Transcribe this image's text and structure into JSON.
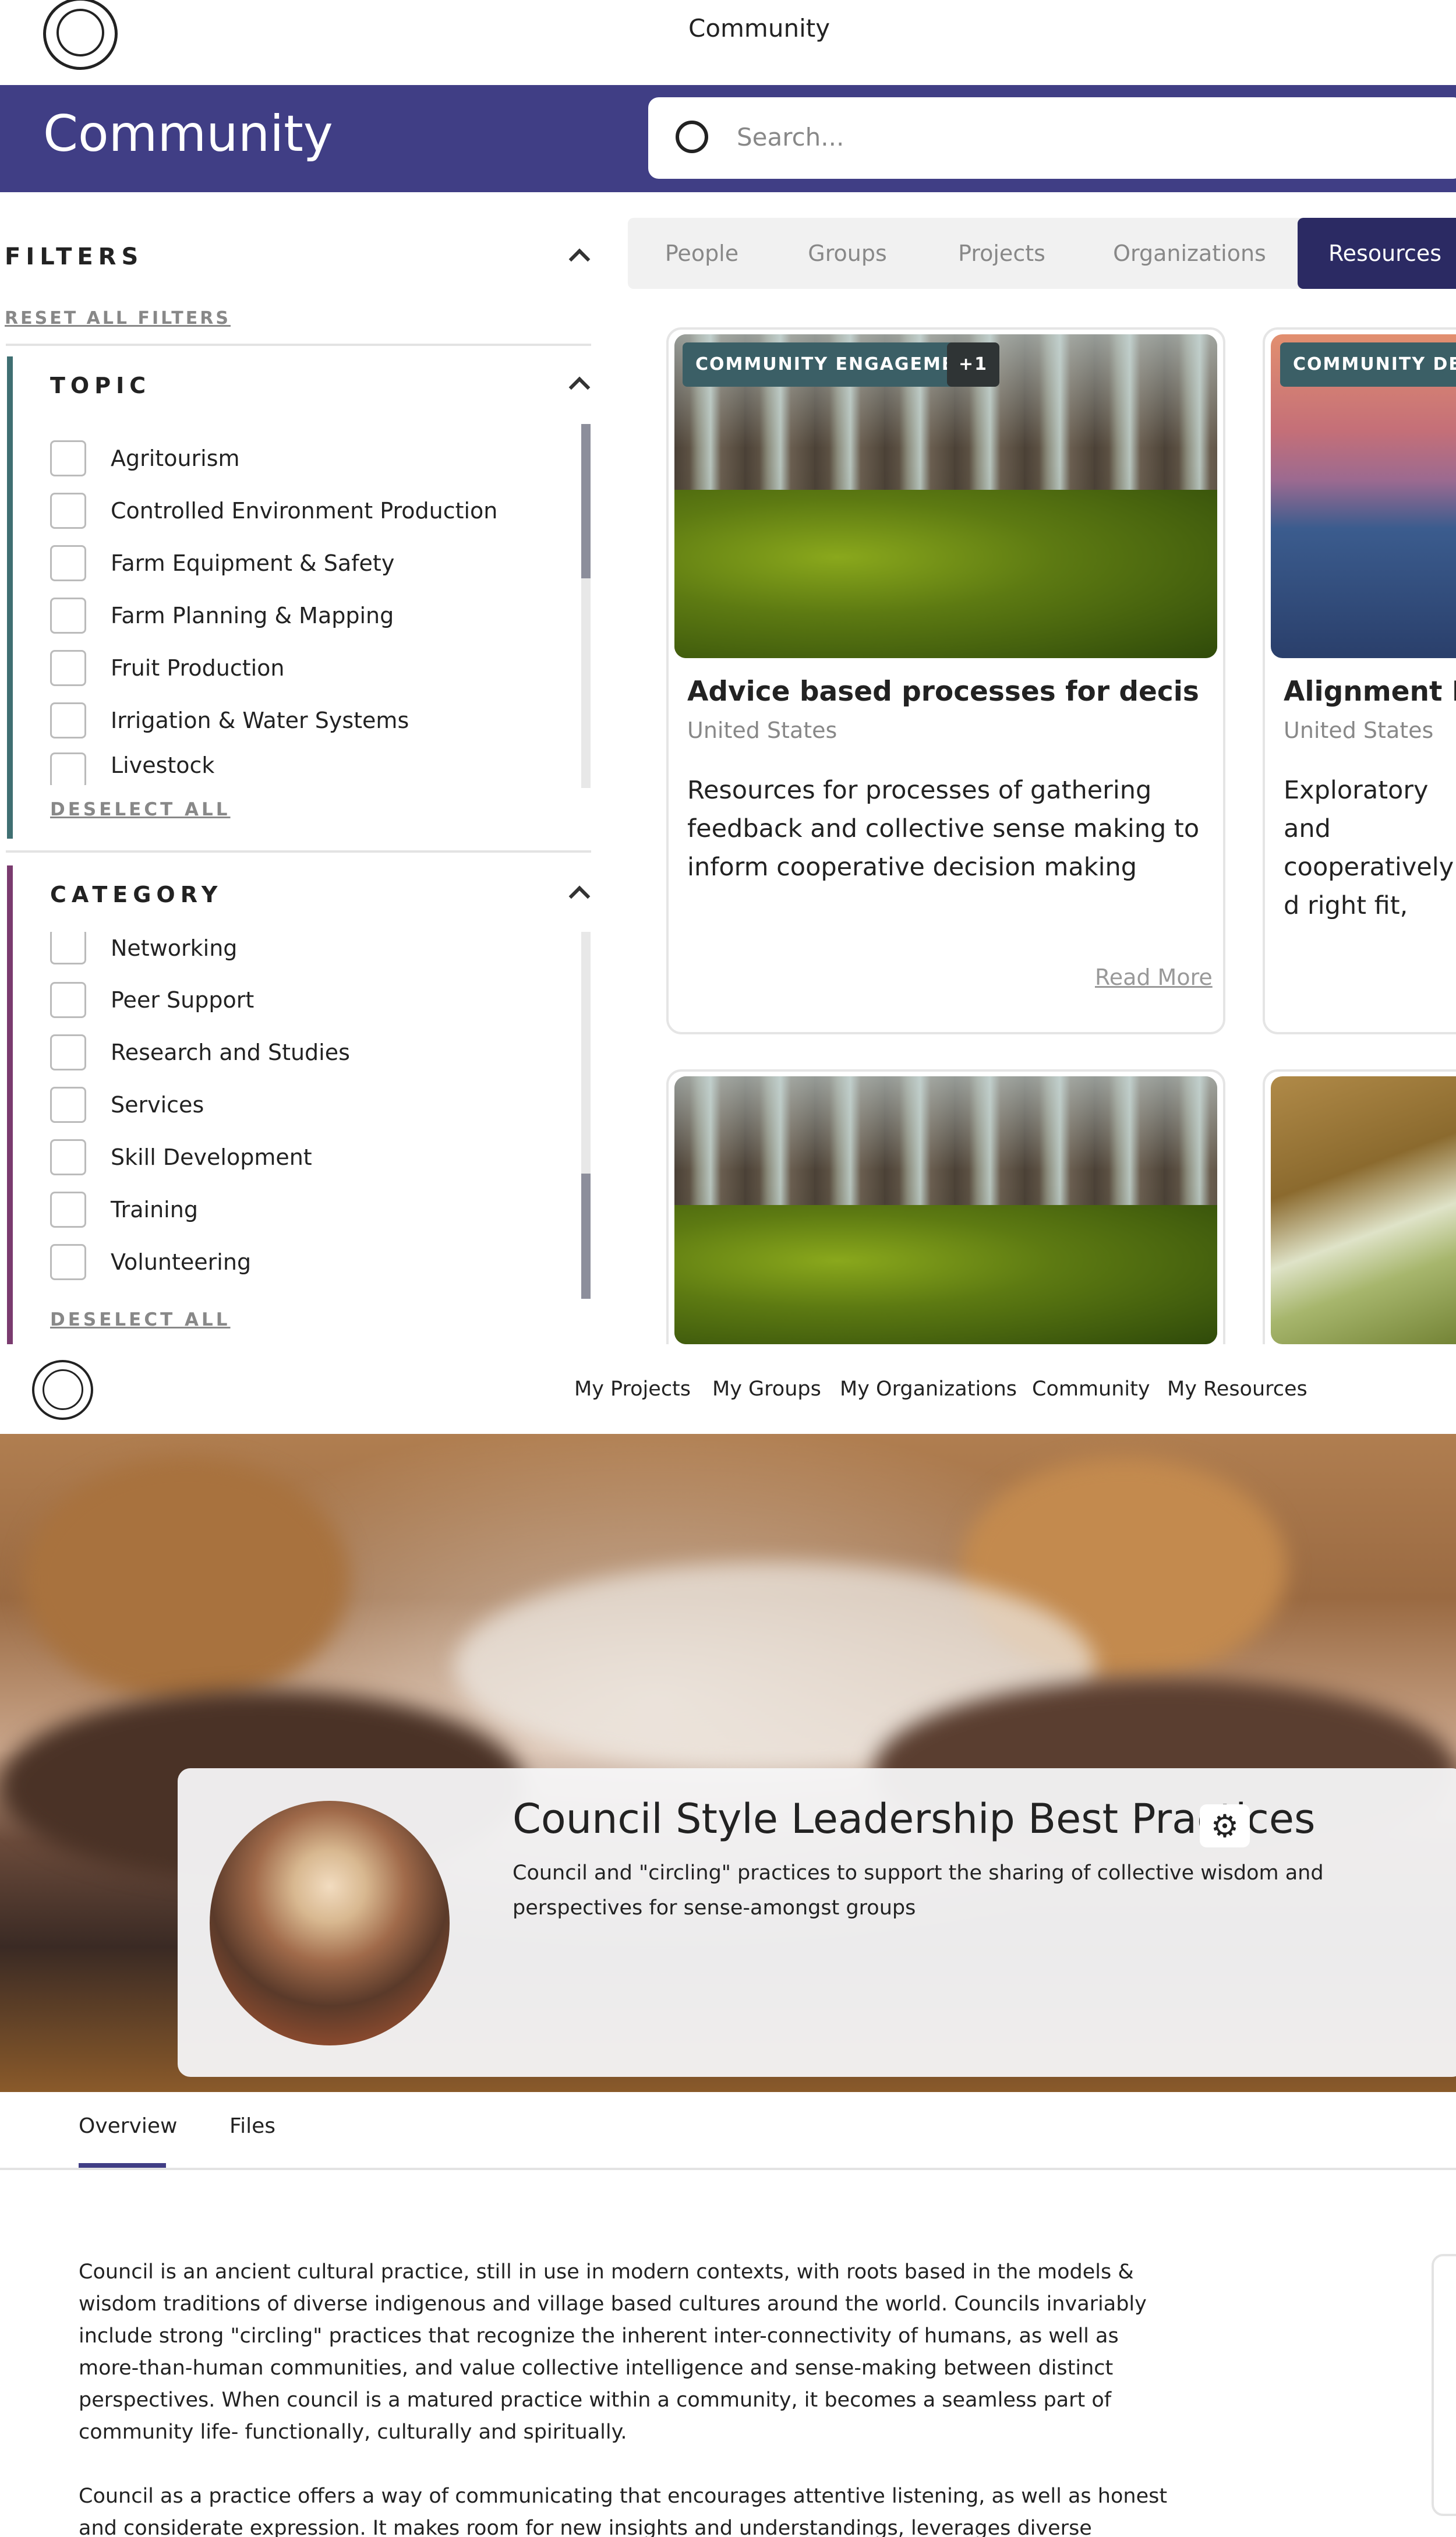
{
  "top_nav": {
    "title": "Community"
  },
  "banner": {
    "title": "Community"
  },
  "search": {
    "placeholder": "Search..."
  },
  "filters": {
    "title": "FILTERS",
    "reset_label": "RESET ALL FILTERS",
    "topic": {
      "title": "TOPIC",
      "items": [
        "Agritourism",
        "Controlled Environment Production",
        "Farm Equipment & Safety",
        "Farm Planning & Mapping",
        "Fruit Production",
        "Irrigation & Water Systems",
        "Livestock"
      ],
      "deselect_label": "DESELECT ALL"
    },
    "category": {
      "title": "CATEGORY",
      "items": [
        "Networking",
        "Peer Support",
        "Research and Studies",
        "Services",
        "Skill Development",
        "Training",
        "Volunteering"
      ],
      "deselect_label": "DESELECT ALL"
    }
  },
  "tabs": [
    {
      "label": "People"
    },
    {
      "label": "Groups"
    },
    {
      "label": "Projects"
    },
    {
      "label": "Organizations"
    },
    {
      "label": "Resources",
      "active": true
    }
  ],
  "cards": [
    {
      "badge": "COMMUNITY ENGAGEMENT",
      "badge_extra": "+1",
      "title": "Advice based processes for decision ma...",
      "location": "United States",
      "description": "Resources for processes of gathering feedback and collective sense making to inform cooperative decision making",
      "read_more": "Read More"
    },
    {
      "badge": "COMMUNITY DECISI",
      "title": "Alignment Pro",
      "location": "United States",
      "description": "Exploratory and cooperatively d right fit, and al relationships."
    }
  ],
  "bottom_nav": {
    "links": [
      "My Projects",
      "My Groups",
      "My Organizations",
      "Community",
      "My Resources"
    ]
  },
  "resource": {
    "title": "Council Style Leadership Best Practices",
    "description": "Council and \"circling\" practices to support the sharing of collective wisdom and perspectives for sense-amongst groups",
    "tabs": [
      "Overview",
      "Files"
    ],
    "paragraphs": [
      "Council is an ancient cultural practice, still in use in modern contexts, with roots based in the models & wisdom traditions of diverse indigenous and village based cultures around the world. Councils invariably include strong \"circling\" practices that recognize the inherent inter-connectivity of humans, as well as more-than-human communities, and value collective intelligence and sense-making between distinct perspectives. When council is a matured practice within a community, it becomes a seamless part of community life- functionally, culturally and spiritually.",
      "Council as a practice offers a way of communicating that encourages attentive listening, as well as honest and considerate expression. It makes room for new insights and understandings, leverages diverse wisdoms in decision"
    ]
  },
  "colors": {
    "brand": "#403e85",
    "tab_active": "#2b2a63",
    "topic_accent": "#3f6f72",
    "category_accent": "#7a3b6f",
    "badge": "#3b5f66"
  }
}
